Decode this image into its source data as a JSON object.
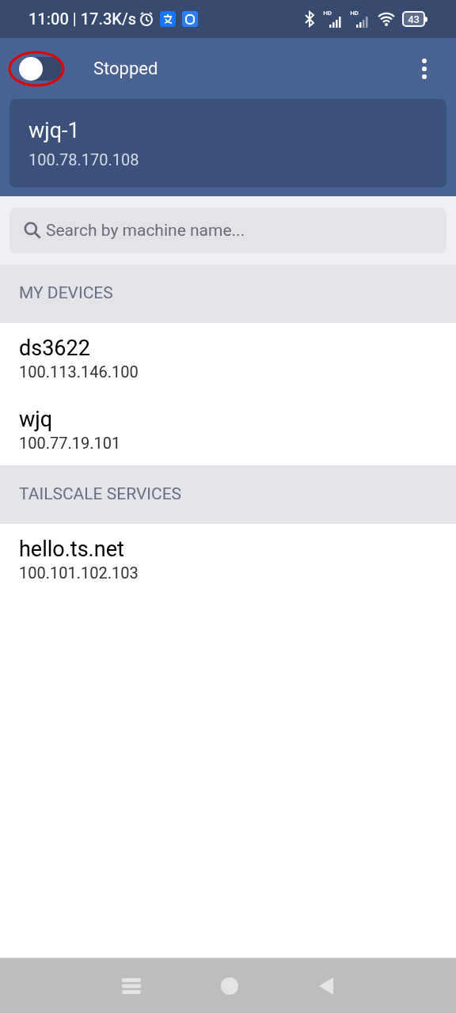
{
  "status_bar": {
    "time": "11:00 | 17.3K/s",
    "signal_labels": [
      "HD",
      "HD"
    ],
    "battery": "43"
  },
  "header": {
    "toggle": {
      "on": false
    },
    "status": "Stopped"
  },
  "current_device": {
    "name": "wjq-1",
    "ip": "100.78.170.108"
  },
  "search": {
    "placeholder": "Search by machine name..."
  },
  "sections": [
    {
      "title": "MY DEVICES",
      "devices": [
        {
          "name": "ds3622",
          "ip": "100.113.146.100"
        },
        {
          "name": "wjq",
          "ip": "100.77.19.101"
        }
      ]
    },
    {
      "title": "TAILSCALE SERVICES",
      "devices": [
        {
          "name": "hello.ts.net",
          "ip": "100.101.102.103"
        }
      ]
    }
  ]
}
